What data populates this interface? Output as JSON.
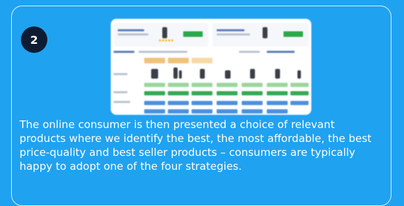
{
  "step": {
    "number": "2"
  },
  "description": "The online consumer is then presented a choice of relevant products where we identify the best, the most affordable, the best price-quality and best seller products – consumers are typically happy to adopt one of the four strategies.",
  "colors": {
    "background": "#1fa2f0",
    "badge": "#0e1c33",
    "accent_green": "#35a853",
    "accent_blue": "#4d8fdc"
  },
  "screenshot": {
    "icon": "product-comparison-screenshot"
  }
}
